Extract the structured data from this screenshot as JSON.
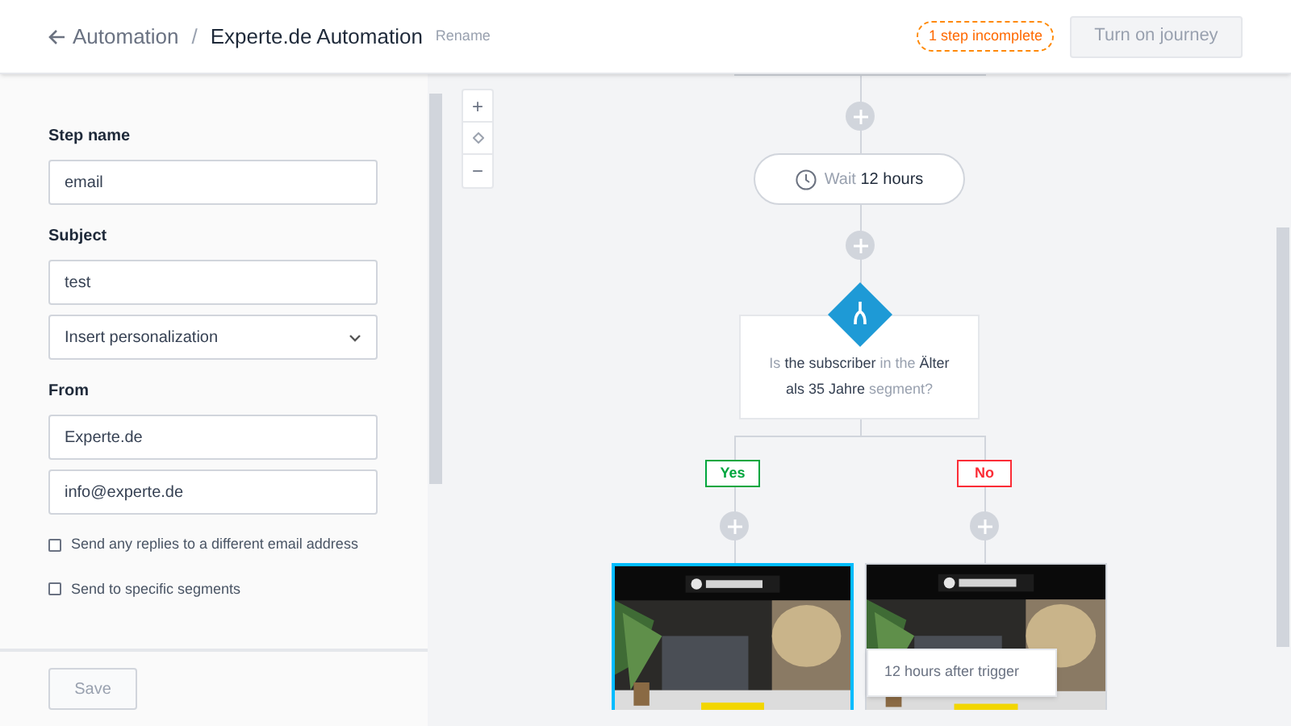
{
  "header": {
    "back_link": "Automation",
    "separator": "/",
    "title": "Experte.de Automation",
    "rename": "Rename",
    "status_badge": "1 step incomplete",
    "primary_button": {
      "label": "Turn on journey",
      "disabled": true
    }
  },
  "form": {
    "sections": [
      {
        "label": "Step name",
        "inputs": [
          {
            "kind": "text",
            "value": "email"
          }
        ]
      },
      {
        "label": "Subject",
        "inputs": [
          {
            "kind": "text",
            "value": "test"
          },
          {
            "kind": "select",
            "value": "Insert personalization"
          }
        ]
      },
      {
        "label": "From",
        "inputs": [
          {
            "kind": "text",
            "value": "Experte.de"
          },
          {
            "kind": "text",
            "value": "info@experte.de"
          }
        ]
      }
    ],
    "checkboxes": [
      {
        "label": "Send any replies to a different email address",
        "checked": false
      },
      {
        "label": "Send to specific segments",
        "checked": false
      }
    ],
    "save_button": {
      "label": "Save",
      "disabled": true
    }
  },
  "canvas": {
    "zoom_in": "+",
    "zoom_out": "−",
    "wait_step": {
      "prefix": "Wait",
      "value": "12 hours"
    },
    "condition": [
      {
        "text": "Is",
        "emphasis": false
      },
      {
        "text": "the subscriber",
        "emphasis": true
      },
      {
        "text": "in the",
        "emphasis": false
      },
      {
        "text": "Älter als 35 Jahre",
        "emphasis": true
      },
      {
        "text": "segment?",
        "emphasis": false
      }
    ],
    "branches": [
      {
        "label": "Yes",
        "kind": "yes",
        "preview": {
          "kind": "picture",
          "selected": true
        }
      },
      {
        "label": "No",
        "kind": "no",
        "preview": {
          "kind": "picture",
          "selected": false
        }
      }
    ],
    "tooltip": "12 hours after trigger"
  }
}
